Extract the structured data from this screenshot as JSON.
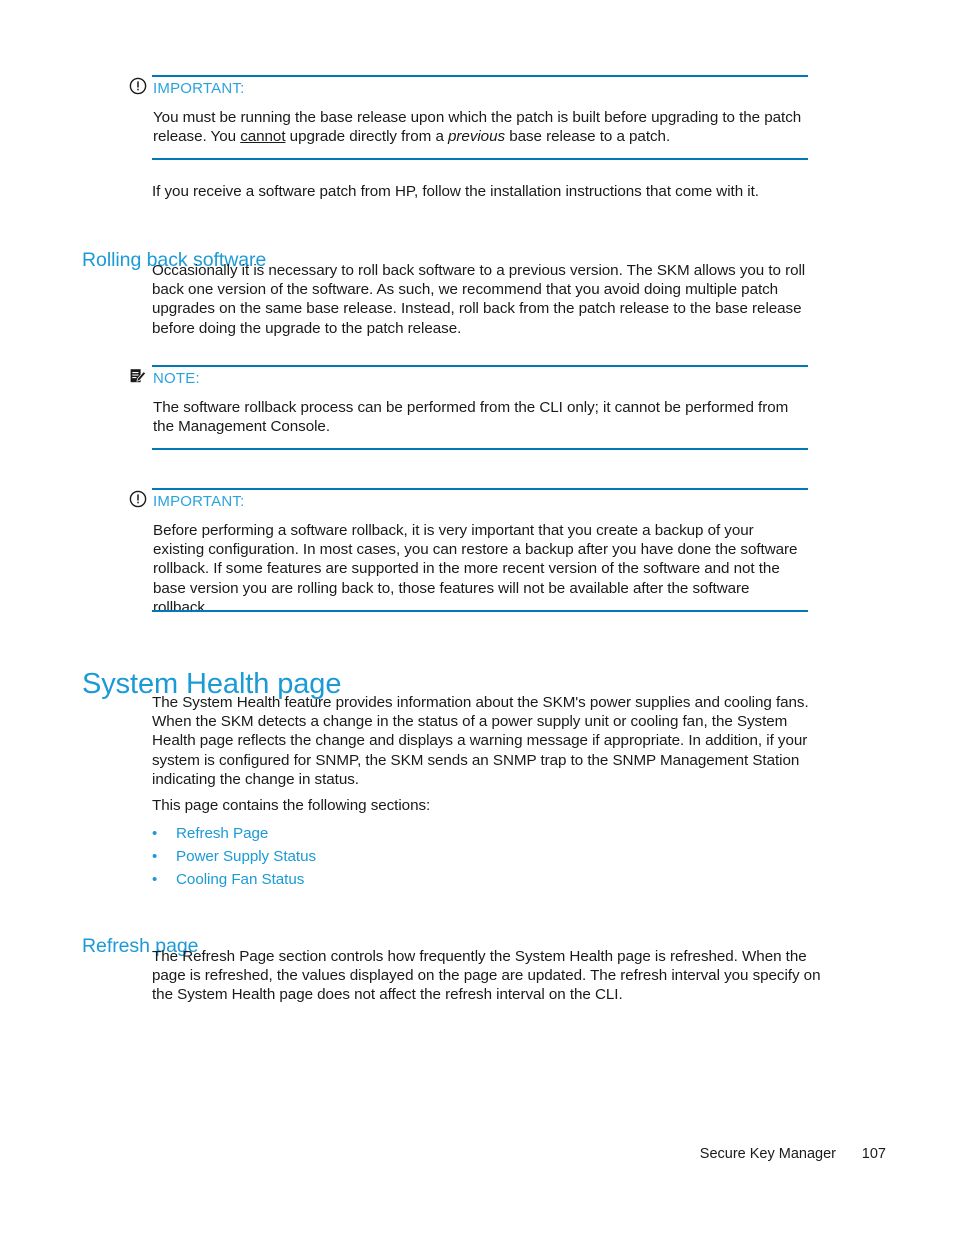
{
  "document": {
    "footer_title": "Secure Key Manager",
    "page_number": "107"
  },
  "admonitions": {
    "important_patch": {
      "icon": "exclamation-circle-icon",
      "label": "IMPORTANT:",
      "body_line1_a": "You must be running the base release upon which the patch is built before upgrading to the patch release. You ",
      "body_cannot": "cannot",
      "body_line1_b": " upgrade directly from a ",
      "body_previous": "previous",
      "body_line1_c": " base release to a patch.",
      "accent_color": "#0079b6",
      "label_color": "#29a3dc"
    },
    "note_rollback": {
      "icon": "note-pencil-icon",
      "label": "NOTE:",
      "body": "The software rollback process can be performed from the CLI only; it cannot be performed from the Management Console.",
      "accent_color": "#0079b6",
      "label_color": "#29a3dc"
    },
    "important_backup": {
      "icon": "exclamation-circle-icon",
      "label": "IMPORTANT:",
      "body": "Before performing a software rollback, it is very important that you create a backup of your existing configuration. In most cases, you can restore a backup after you have done the software rollback. If some features are supported in the more recent version of the software and not the base version you are rolling back to, those features will not be available after the software rollback.",
      "accent_color": "#0079b6",
      "label_color": "#29a3dc"
    }
  },
  "content": {
    "patch_followup": "If you receive a software patch from HP, follow the installation instructions that come with it.",
    "rolling_back_heading": "Rolling back software",
    "rolling_back_para": "Occasionally it is necessary to roll back software to a previous version. The SKM allows you to roll back one version of the software. As such, we recommend that you avoid doing multiple patch upgrades on the same base release. Instead, roll back from the patch release to the base release before doing the upgrade to the patch release.",
    "system_health_heading": "System Health page",
    "system_health_para": "The System Health feature provides information about the SKM's power supplies and cooling fans. When the SKM detects a change in the status of a power supply unit or cooling fan, the System Health page reflects the change and displays a warning message if appropriate. In addition, if your system is configured for SNMP, the SKM sends an SNMP trap to the SNMP Management Station indicating the change in status.",
    "sections_intro": "This page contains the following sections:",
    "section_links": [
      {
        "label": "Refresh Page"
      },
      {
        "label": "Power Supply Status"
      },
      {
        "label": "Cooling Fan Status"
      }
    ],
    "refresh_page_heading": "Refresh page",
    "refresh_page_para": "The Refresh Page section controls how frequently the System Health page is refreshed. When the page is refreshed, the values displayed on the page are updated. The refresh interval you specify on the System Health page does not affect the refresh interval on the CLI."
  },
  "colors": {
    "heading_blue": "#1b9ad6",
    "rule_blue": "#0079b6",
    "body_black": "#1a1a1a"
  }
}
